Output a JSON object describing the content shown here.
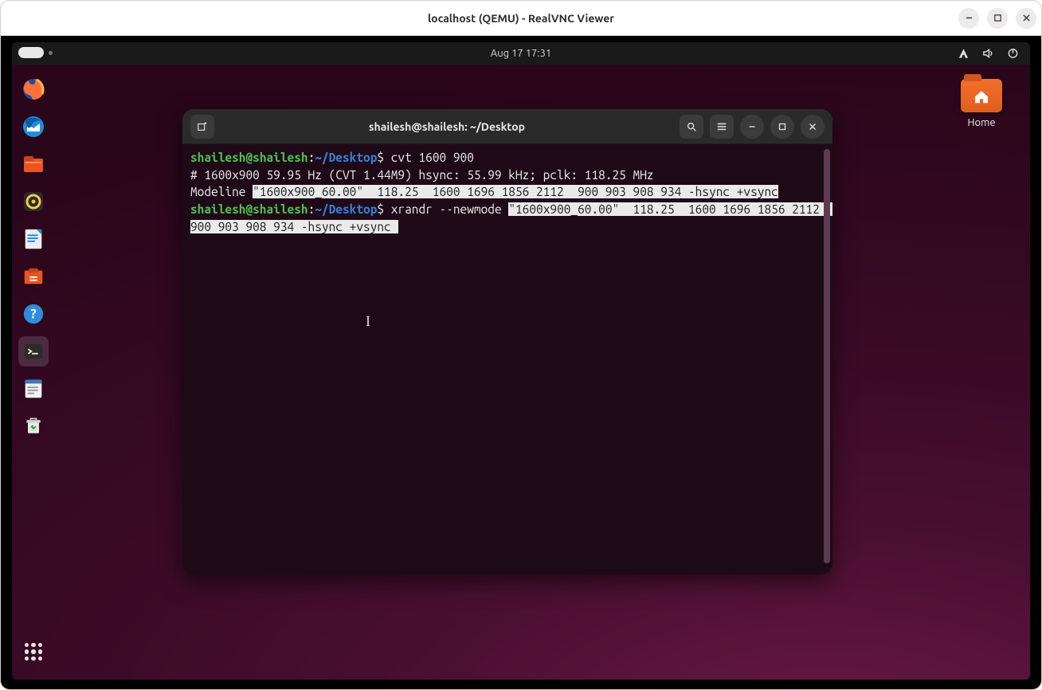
{
  "vnc": {
    "title": "localhost (QEMU) - RealVNC Viewer"
  },
  "gnome": {
    "clock": "Aug 17  17:31"
  },
  "desktop": {
    "home_label": "Home"
  },
  "terminal": {
    "title": "shailesh@shailesh: ~/Desktop",
    "prompt_user": "shailesh@shailesh",
    "prompt_colon": ":",
    "prompt_path": "~/Desktop",
    "prompt_dollar": "$ ",
    "line1_cmd": "cvt 1600 900",
    "line2": "# 1600x900 59.95 Hz (CVT 1.44M9) hsync: 55.99 kHz; pclk: 118.25 MHz",
    "line3_pre": "Modeline ",
    "line3_sel": "\"1600x900_60.00\"  118.25  1600 1696 1856 2112  900 903 908 934 -hsync +vsync",
    "line5_cmd": "xrandr --newmode ",
    "line5_sel": "\"1600x900_60.00\"  118.25  1600 1696 1856 2112  900 903 908 934 -hsync +vsync"
  }
}
